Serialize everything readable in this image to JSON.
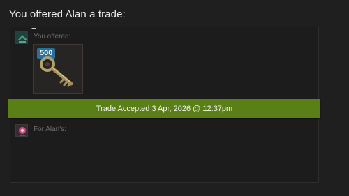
{
  "heading": "You offered Alan a trade:",
  "you_section": {
    "label": "You offered:",
    "avatar_icon": "green-avatar-icon",
    "items": [
      {
        "quantity_badge": "500",
        "icon": "key-icon"
      }
    ]
  },
  "banner": {
    "text": "Trade Accepted 3 Apr, 2026 @ 12:37pm",
    "color": "#5b7f17"
  },
  "alan_section": {
    "label": "For Alan's:",
    "avatar_icon": "pink-avatar-icon"
  },
  "colors": {
    "background": "#1f1f1f",
    "badge": "#2a6f9c"
  }
}
